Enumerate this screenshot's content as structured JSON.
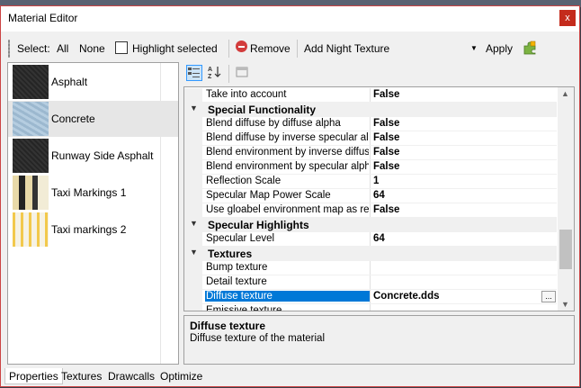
{
  "window": {
    "title": "Material Editor",
    "close_label": "x"
  },
  "toolbar": {
    "select_label": "Select:",
    "all_label": "All",
    "none_label": "None",
    "highlight_label": "Highlight selected",
    "remove_label": "Remove",
    "night_texture_label": "Add Night Texture",
    "apply_label": "Apply"
  },
  "materials": [
    {
      "label": "Asphalt",
      "thumb": "asphalt"
    },
    {
      "label": "Concrete",
      "thumb": "concrete"
    },
    {
      "label": "Runway Side Asphalt",
      "thumb": "asphalt"
    },
    {
      "label": "Taxi Markings 1",
      "thumb": "markings"
    },
    {
      "label": "Taxi markings 2",
      "thumb": "markings2"
    }
  ],
  "property_grid": {
    "rows": [
      {
        "type": "prop",
        "name": "Take into account",
        "value": "False"
      },
      {
        "type": "cat",
        "name": "Special Functionality"
      },
      {
        "type": "prop",
        "name": "Blend diffuse by diffuse alpha",
        "value": "False"
      },
      {
        "type": "prop",
        "name": "Blend diffuse by inverse specular alpha",
        "value": "False"
      },
      {
        "type": "prop",
        "name": "Blend environment by inverse diffuse alpha",
        "value": "False"
      },
      {
        "type": "prop",
        "name": "Blend environment by specular alpha",
        "value": "False"
      },
      {
        "type": "prop",
        "name": "Reflection Scale",
        "value": "1"
      },
      {
        "type": "prop",
        "name": "Specular Map Power Scale",
        "value": "64"
      },
      {
        "type": "prop",
        "name": "Use gloabel environment map as reflection",
        "value": "False"
      },
      {
        "type": "cat",
        "name": "Specular Highlights"
      },
      {
        "type": "prop",
        "name": "Specular Level",
        "value": "64"
      },
      {
        "type": "cat",
        "name": "Textures"
      },
      {
        "type": "prop",
        "name": "Bump texture",
        "value": ""
      },
      {
        "type": "prop",
        "name": "Detail texture",
        "value": ""
      },
      {
        "type": "prop",
        "name": "Diffuse texture",
        "value": "Concrete.dds",
        "selected": true
      },
      {
        "type": "prop",
        "name": "Emissive texture",
        "value": ""
      }
    ]
  },
  "description": {
    "title": "Diffuse texture",
    "text": "Diffuse texture of the material"
  },
  "tabs": [
    {
      "label": "Properties",
      "active": true
    },
    {
      "label": "Textures"
    },
    {
      "label": "Drawcalls"
    },
    {
      "label": "Optimize"
    }
  ],
  "colors": {
    "accent": "#0078d7",
    "close": "#c42b1c"
  }
}
